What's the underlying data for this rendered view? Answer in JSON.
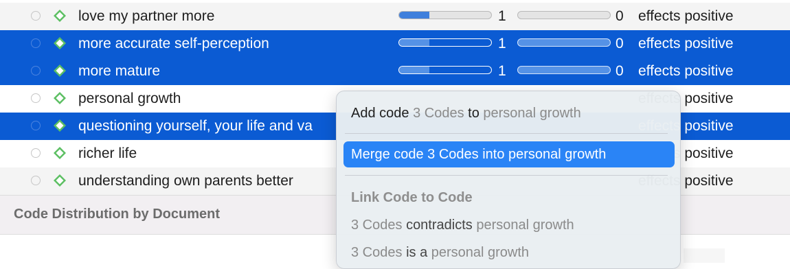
{
  "rows": [
    {
      "label": "love my partner more",
      "count1": "1",
      "fill1": 0.33,
      "count2": "0",
      "relation": "effects positive",
      "state": "alt"
    },
    {
      "label": "more accurate self-perception",
      "count1": "1",
      "fill1": 0.33,
      "count2": "0",
      "relation": "effects positive",
      "state": "sel"
    },
    {
      "label": "more mature",
      "count1": "1",
      "fill1": 0.33,
      "count2": "0",
      "relation": "effects positive",
      "state": "sel"
    },
    {
      "label": "personal growth",
      "count1": "",
      "fill1": 0,
      "count2": "",
      "relation": "effects positive",
      "state": "plain"
    },
    {
      "label": "questioning yourself, your life and va",
      "count1": "",
      "fill1": 0,
      "count2": "",
      "relation": "effects positive",
      "state": "sel"
    },
    {
      "label": "richer life",
      "count1": "",
      "fill1": 0,
      "count2": "",
      "relation": "effects positive",
      "state": "plain"
    },
    {
      "label": "understanding own parents better",
      "count1": "",
      "fill1": 0,
      "count2": "",
      "relation": "effects positive",
      "state": "alt"
    }
  ],
  "section": {
    "title": "Code Distribution by Document"
  },
  "menu": {
    "add": {
      "prefix": "Add code",
      "subject": "3 Codes",
      "mid": "to",
      "target": "personal growth"
    },
    "merge": {
      "label": "Merge code 3 Codes into personal growth"
    },
    "link_header": "Link Code to Code",
    "links": [
      {
        "subject": "3 Codes",
        "verb": "contradicts",
        "target": "personal growth"
      },
      {
        "subject": "3 Codes",
        "verb": "is a",
        "target": "personal growth"
      }
    ]
  },
  "colors": {
    "selection": "#0b5bd3",
    "highlight": "#2a84f6",
    "code_icon": "#5cbf62"
  },
  "icons": {
    "row_code": "diamond-code-icon",
    "row_radio": "radio-circle-icon"
  }
}
